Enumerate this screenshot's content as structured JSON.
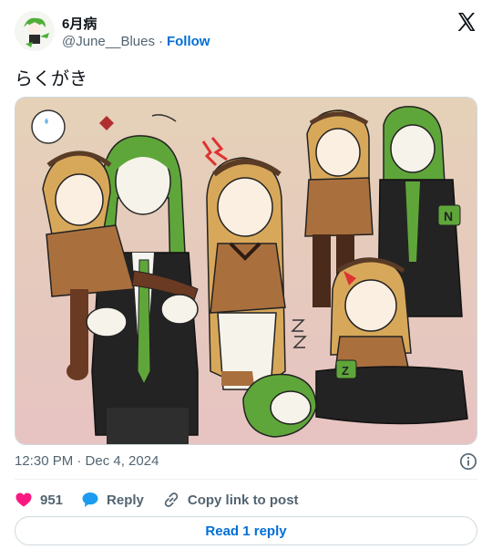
{
  "author": {
    "name": "6月病",
    "handle": "@June__Blues",
    "separator": "·",
    "follow_label": "Follow"
  },
  "tweet": {
    "text": "らくがき",
    "timestamp": "12:30 PM · Dec 4, 2024"
  },
  "actions": {
    "like_count": "951",
    "reply_label": "Reply",
    "copy_label": "Copy link to post"
  },
  "read_reply_label": "Read 1 reply",
  "icons": {
    "brand": "x-logo-icon",
    "info": "info-icon",
    "like": "heart-icon",
    "reply": "speech-bubble-icon",
    "copy": "link-icon"
  },
  "colors": {
    "like": "#f91880",
    "reply": "#1d9bf0",
    "link": "#006fd6",
    "secondary_text": "#536471"
  }
}
